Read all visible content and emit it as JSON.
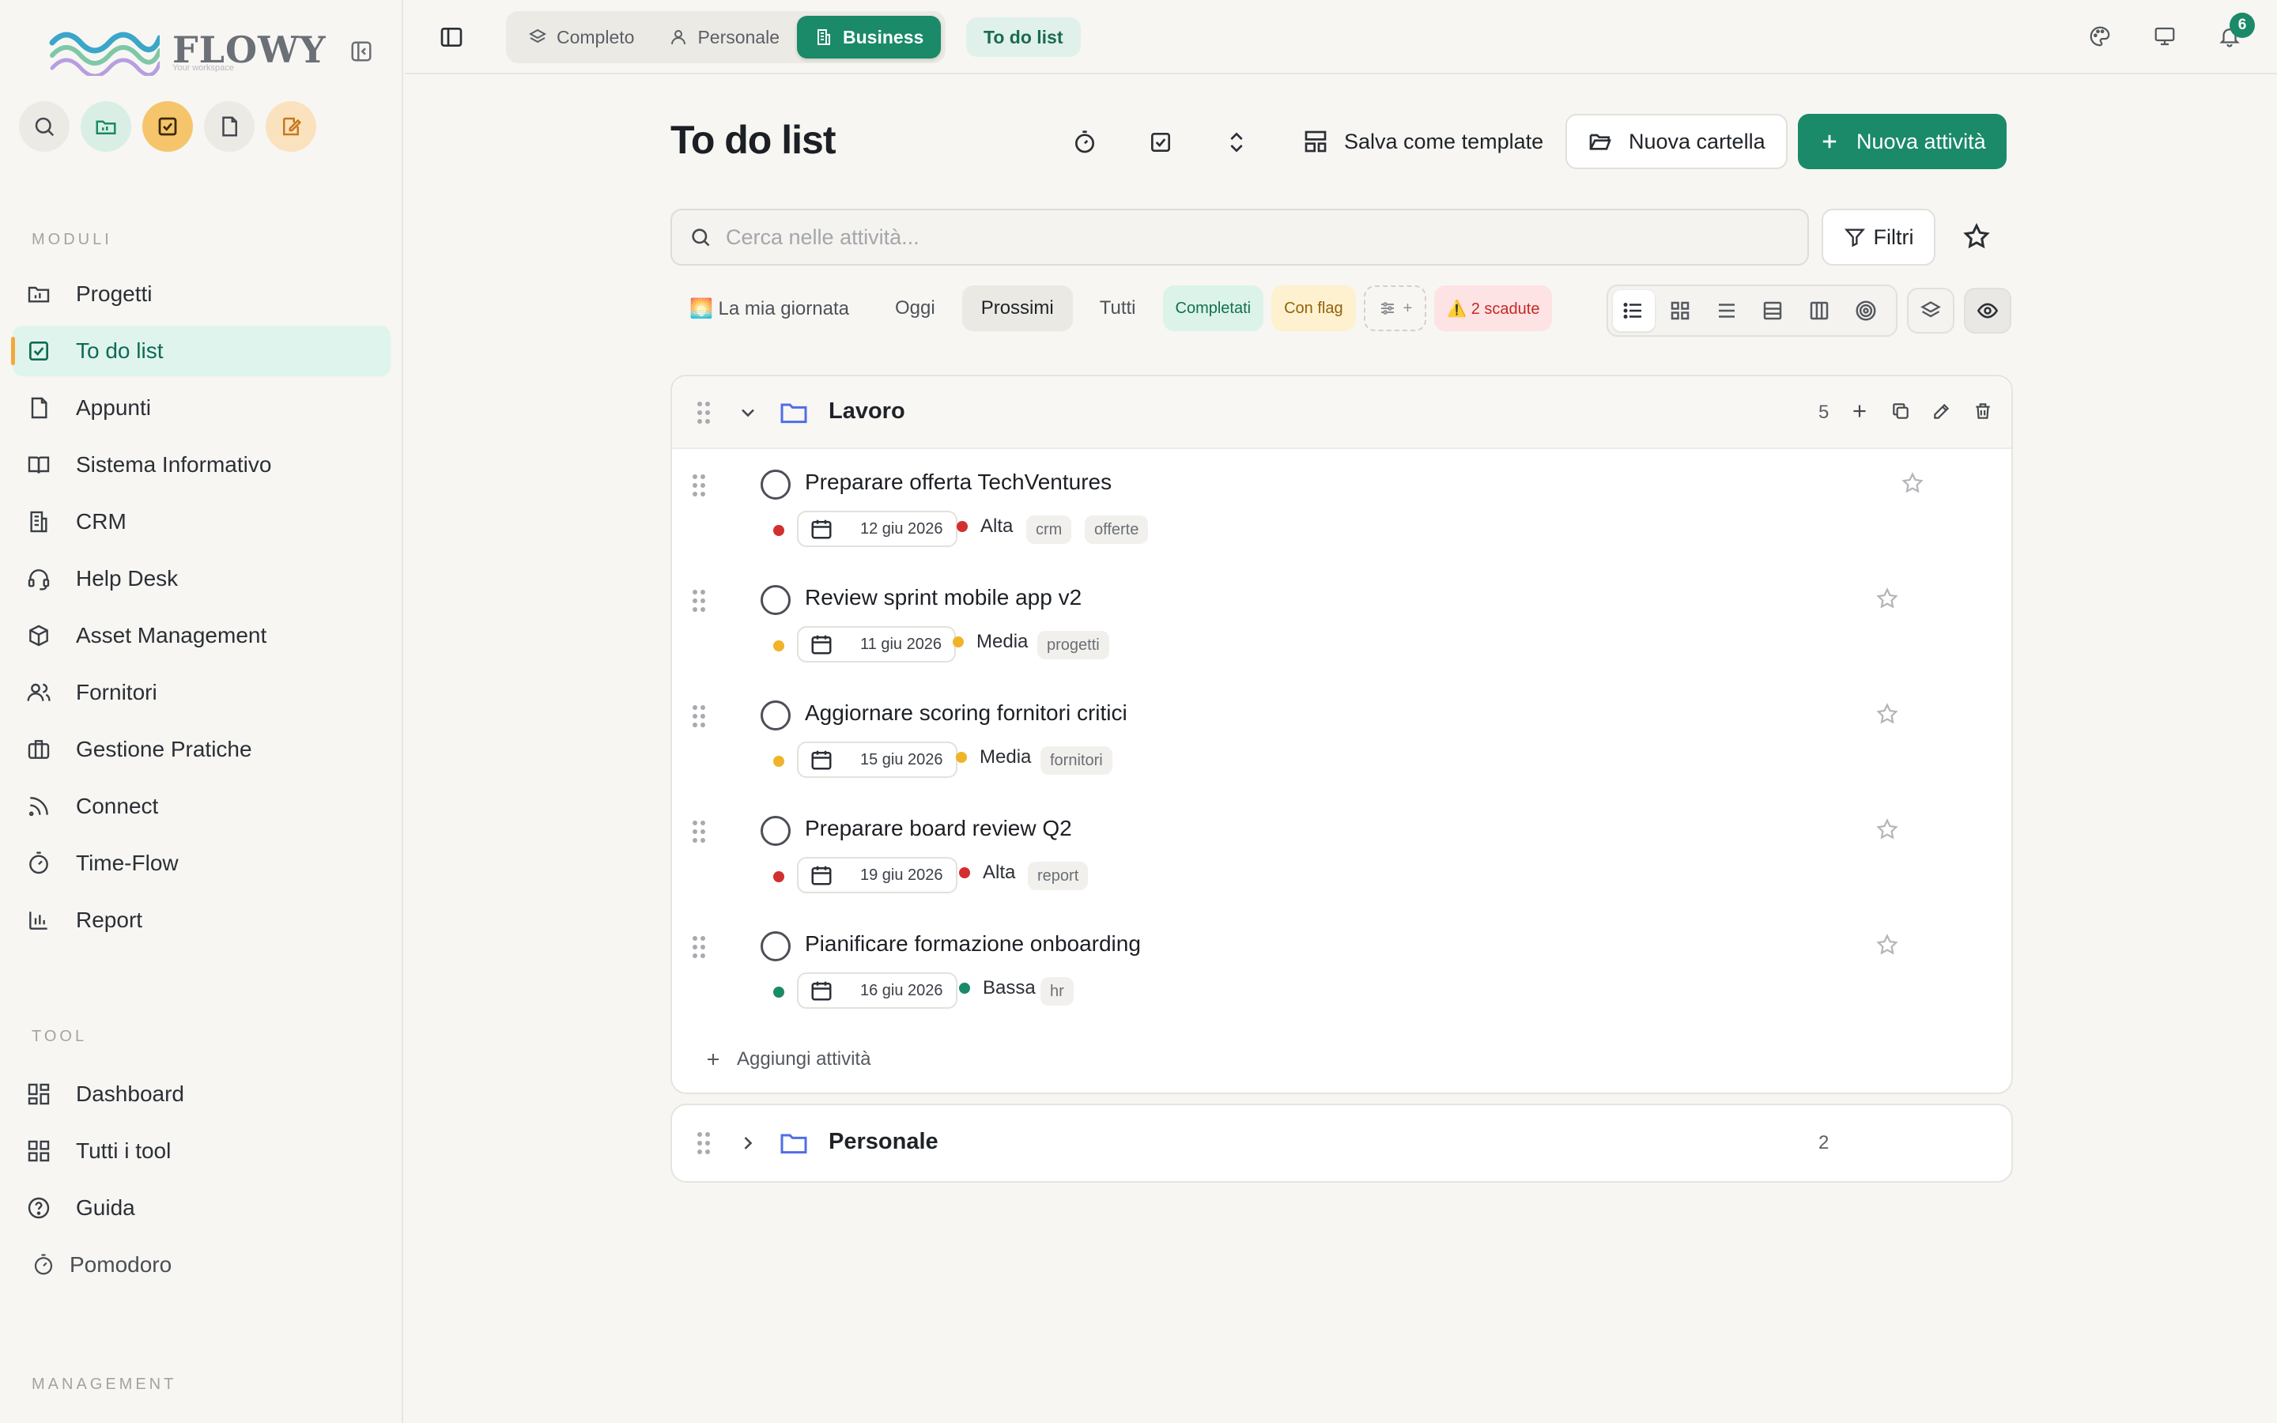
{
  "app": {
    "name": "FLOWY",
    "tagline": "Your workspace"
  },
  "colors": {
    "brand": "#1a8a68",
    "accent_orange": "#f2a93b",
    "priority_high": "#d32f2f",
    "priority_medium": "#f0b429",
    "priority_low": "#1a8a68"
  },
  "sidebar": {
    "quick_actions": [
      "search-icon",
      "projects-icon",
      "todo-icon",
      "notes-icon",
      "edit-note-icon"
    ],
    "section_modules": "MODULI",
    "modules": [
      {
        "label": "Progetti",
        "icon": "folder-chart-icon"
      },
      {
        "label": "To do list",
        "icon": "checkbox-icon",
        "active": true
      },
      {
        "label": "Appunti",
        "icon": "note-icon"
      },
      {
        "label": "Sistema Informativo",
        "icon": "book-icon"
      },
      {
        "label": "CRM",
        "icon": "building-icon"
      },
      {
        "label": "Help Desk",
        "icon": "headset-icon"
      },
      {
        "label": "Asset Management",
        "icon": "box-icon"
      },
      {
        "label": "Fornitori",
        "icon": "users-icon"
      },
      {
        "label": "Gestione Pratiche",
        "icon": "briefcase-icon"
      },
      {
        "label": "Connect",
        "icon": "rss-icon"
      },
      {
        "label": "Time-Flow",
        "icon": "timer-icon"
      },
      {
        "label": "Report",
        "icon": "bar-chart-icon"
      }
    ],
    "section_tool": "TOOL",
    "tools": [
      {
        "label": "Dashboard",
        "icon": "dashboard-icon"
      },
      {
        "label": "Tutti i tool",
        "icon": "grid-icon"
      },
      {
        "label": "Guida",
        "icon": "help-icon"
      }
    ],
    "pomodoro": "Pomodoro",
    "section_management": "MANAGEMENT"
  },
  "topbar": {
    "segments": [
      {
        "label": "Completo",
        "icon": "layers-icon"
      },
      {
        "label": "Personale",
        "icon": "user-icon"
      },
      {
        "label": "Business",
        "icon": "building-icon",
        "active": true
      }
    ],
    "breadcrumb": "To do list",
    "notification_count": "6"
  },
  "header": {
    "title": "To do list",
    "save_template": "Salva come template",
    "new_folder": "Nuova cartella",
    "new_task": "Nuova attività"
  },
  "search": {
    "placeholder": "Cerca nelle attività...",
    "filters_label": "Filtri"
  },
  "filters": {
    "my_day": "🌅 La mia giornata",
    "today": "Oggi",
    "upcoming": "Prossimi",
    "all": "Tutti",
    "completed": "Completati",
    "flagged": "Con flag",
    "custom": "+",
    "overdue": "⚠️ 2 scadute",
    "active": "Prossimi"
  },
  "folders": [
    {
      "name": "Lavoro",
      "count": "5",
      "expanded": true,
      "add_task_label": "Aggiungi attività",
      "tasks": [
        {
          "title": "Preparare offerta TechVentures",
          "date": "12 giu 2026",
          "priority": "Alta",
          "priority_color": "#d32f2f",
          "tags": [
            "crm",
            "offerte"
          ]
        },
        {
          "title": "Review sprint mobile app v2",
          "date": "11 giu 2026",
          "priority": "Media",
          "priority_color": "#f0b429",
          "tags": [
            "progetti"
          ]
        },
        {
          "title": "Aggiornare scoring fornitori critici",
          "date": "15 giu 2026",
          "priority": "Media",
          "priority_color": "#f0b429",
          "tags": [
            "fornitori"
          ]
        },
        {
          "title": "Preparare board review Q2",
          "date": "19 giu 2026",
          "priority": "Alta",
          "priority_color": "#d32f2f",
          "tags": [
            "report"
          ]
        },
        {
          "title": "Pianificare formazione onboarding",
          "date": "16 giu 2026",
          "priority": "Bassa",
          "priority_color": "#1a8a68",
          "tags": [
            "hr"
          ]
        }
      ]
    },
    {
      "name": "Personale",
      "count": "2",
      "expanded": false
    }
  ]
}
